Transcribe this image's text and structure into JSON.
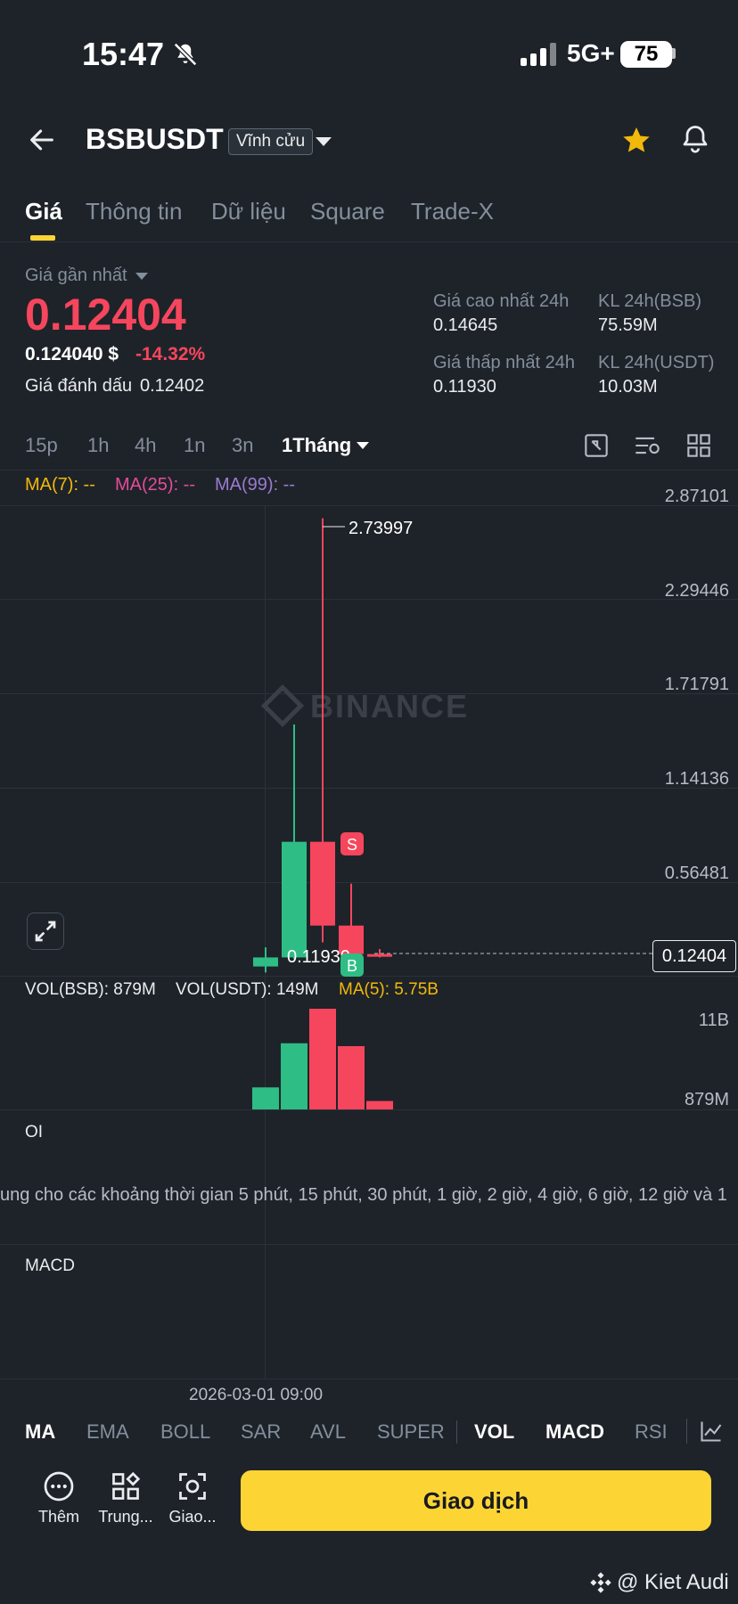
{
  "status_bar": {
    "time": "15:47",
    "network": "5G+",
    "battery": "75"
  },
  "header": {
    "symbol": "BSBUSDT",
    "contract_type": "Vĩnh cửu"
  },
  "tabs": [
    {
      "label": "Giá",
      "active": true
    },
    {
      "label": "Thông tin"
    },
    {
      "label": "Dữ liệu"
    },
    {
      "label": "Square"
    },
    {
      "label": "Trade-X"
    }
  ],
  "price": {
    "last_label": "Giá gần nhất",
    "last": "0.12404",
    "usd": "0.124040 $",
    "change": "-14.32%",
    "mark_label": "Giá đánh dấu",
    "mark": "0.12402"
  },
  "stats": {
    "high_label": "Giá cao nhất 24h",
    "high": "0.14645",
    "vol_bsb_label": "KL 24h(BSB)",
    "vol_bsb": "75.59M",
    "low_label": "Giá thấp nhất 24h",
    "low": "0.11930",
    "vol_usdt_label": "KL 24h(USDT)",
    "vol_usdt": "10.03M"
  },
  "timeframes": [
    "15p",
    "1h",
    "4h",
    "1n",
    "3n",
    "1Tháng"
  ],
  "ma": {
    "ma7": "MA(7): --",
    "ma25": "MA(25): --",
    "ma99": "MA(99): --"
  },
  "y_axis": [
    "2.87101",
    "2.29446",
    "1.71791",
    "1.14136",
    "0.56481"
  ],
  "chart_labels": {
    "high": "2.73997",
    "low": "0.11930",
    "current": "0.12404",
    "sell": "S",
    "buy": "B"
  },
  "watermark": "BINANCE",
  "volume": {
    "vol_bsb": "VOL(BSB): 879M",
    "vol_usdt": "VOL(USDT): 149M",
    "ma5": "MA(5): 5.75B",
    "top": "11B",
    "bottom": "879M"
  },
  "oi": {
    "label": "OI",
    "note": "ung cho các khoảng thời gian 5 phút, 15 phút, 30 phút, 1 giờ, 2 giờ, 4 giờ, 6 giờ, 12 giờ và 1"
  },
  "macd_label": "MACD",
  "time_label": "2026-03-01 09:00",
  "indicators": [
    "MA",
    "EMA",
    "BOLL",
    "SAR",
    "AVL",
    "SUPER",
    "VOL",
    "MACD",
    "RSI"
  ],
  "bottom": {
    "more": "Thêm",
    "center": "Trung...",
    "trade_short": "Giao...",
    "trade_button": "Giao dịch"
  },
  "credit": "@ Kiet Audi",
  "colors": {
    "up": "#2ebd85",
    "down": "#f6465d",
    "accent": "#fcd535",
    "ma7": "#f0b90b",
    "ma25": "#e44c9a",
    "ma99": "#9b7bd1"
  },
  "chart_data": {
    "type": "candlestick",
    "candles": [
      {
        "open": 0.066,
        "close": 0.12,
        "high": 0.18,
        "low": 0.03
      },
      {
        "open": 0.12,
        "close": 0.81,
        "high": 1.51,
        "low": 0.11
      },
      {
        "open": 0.81,
        "close": 0.31,
        "high": 2.73997,
        "low": 0.21
      },
      {
        "open": 0.31,
        "close": 0.14,
        "high": 0.56,
        "low": 0.1193
      },
      {
        "open": 0.14,
        "close": 0.12404,
        "high": 0.17,
        "low": 0.12
      }
    ],
    "volumes": [
      2.3,
      6.9,
      10.5,
      6.6,
      0.879
    ],
    "volume_unit": "B",
    "ylim": [
      0,
      2.87101
    ],
    "x": [
      "2026-03-01 09:00"
    ]
  }
}
